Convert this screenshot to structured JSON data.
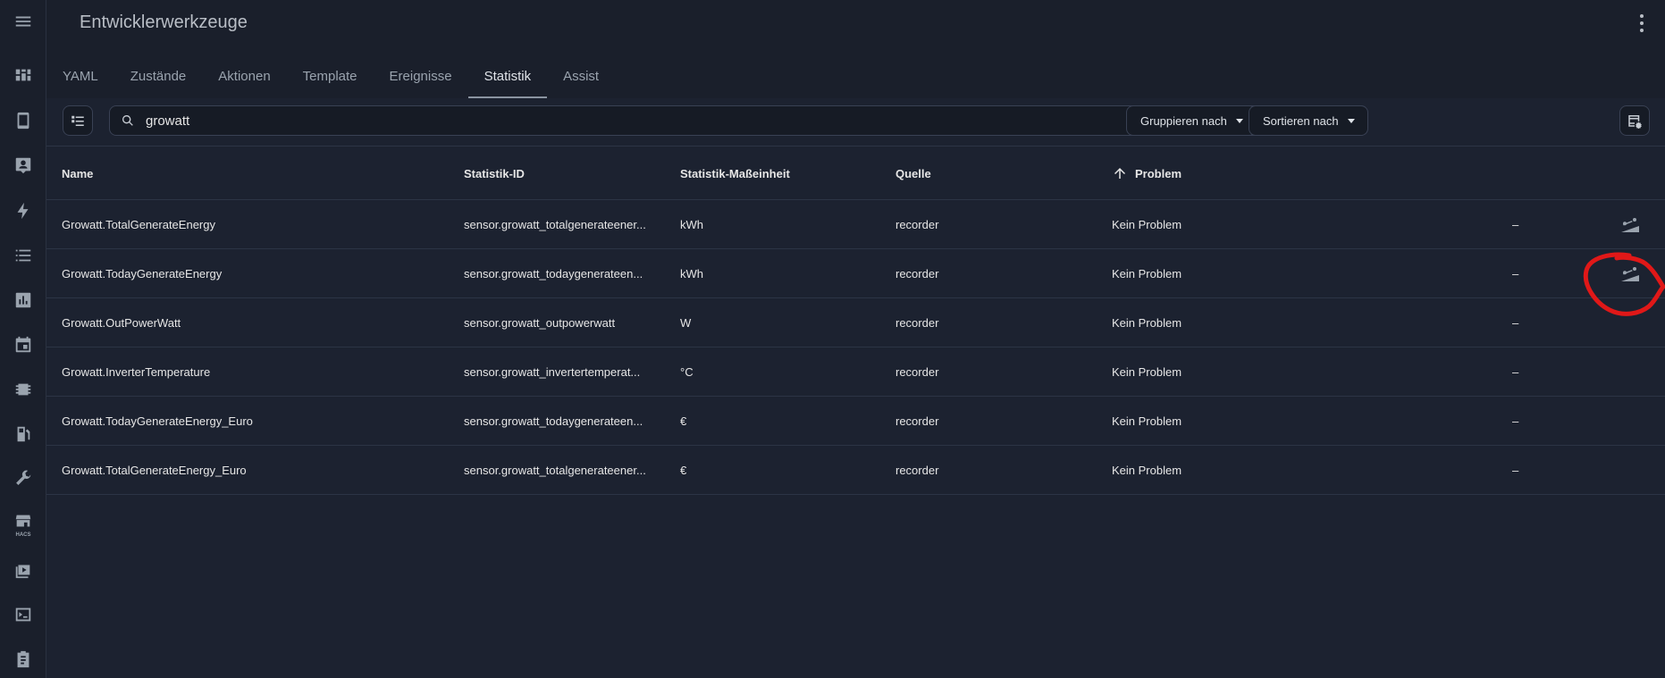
{
  "app": {
    "title": "Entwicklerwerkzeuge"
  },
  "sidebar": {
    "icons": [
      "menu-icon",
      "dashboard-icon",
      "tablet-icon",
      "account-box-icon",
      "lightning-icon",
      "list-icon",
      "chart-bar-icon",
      "calendar-icon",
      "chip-icon",
      "fuel-pump-icon",
      "wrench-icon",
      "hacs-store-icon",
      "media-play-icon",
      "console-icon",
      "clipboard-icon"
    ],
    "hacs_label": "HACS"
  },
  "tabs": [
    {
      "label": "YAML",
      "active": false
    },
    {
      "label": "Zustände",
      "active": false
    },
    {
      "label": "Aktionen",
      "active": false
    },
    {
      "label": "Template",
      "active": false
    },
    {
      "label": "Ereignisse",
      "active": false
    },
    {
      "label": "Statistik",
      "active": true
    },
    {
      "label": "Assist",
      "active": false
    }
  ],
  "toolbar": {
    "search_value": "growatt",
    "group_label": "Gruppieren nach",
    "sort_label": "Sortieren nach"
  },
  "table": {
    "columns": {
      "name": "Name",
      "id": "Statistik-ID",
      "unit": "Statistik-Maßeinheit",
      "source": "Quelle",
      "problem": "Problem"
    },
    "sort_icon": "arrow-up-icon",
    "rows": [
      {
        "name": "Growatt.TotalGenerateEnergy",
        "id": "sensor.growatt_totalgenerateener...",
        "unit": "kWh",
        "source": "recorder",
        "problem": "Kein Problem",
        "dash": "–",
        "action_icon": "adjust-sum-icon"
      },
      {
        "name": "Growatt.TodayGenerateEnergy",
        "id": "sensor.growatt_todaygenerateen...",
        "unit": "kWh",
        "source": "recorder",
        "problem": "Kein Problem",
        "dash": "–",
        "action_icon": "adjust-sum-icon"
      },
      {
        "name": "Growatt.OutPowerWatt",
        "id": "sensor.growatt_outpowerwatt",
        "unit": "W",
        "source": "recorder",
        "problem": "Kein Problem",
        "dash": "–",
        "action_icon": ""
      },
      {
        "name": "Growatt.InverterTemperature",
        "id": "sensor.growatt_invertertemperat...",
        "unit": "°C",
        "source": "recorder",
        "problem": "Kein Problem",
        "dash": "–",
        "action_icon": ""
      },
      {
        "name": "Growatt.TodayGenerateEnergy_Euro",
        "id": "sensor.growatt_todaygenerateen...",
        "unit": "€",
        "source": "recorder",
        "problem": "Kein Problem",
        "dash": "–",
        "action_icon": ""
      },
      {
        "name": "Growatt.TotalGenerateEnergy_Euro",
        "id": "sensor.growatt_totalgenerateener...",
        "unit": "€",
        "source": "recorder",
        "problem": "Kein Problem",
        "dash": "–",
        "action_icon": ""
      }
    ]
  },
  "colors": {
    "annotation": "#e01818",
    "accent": "#8a93a0"
  }
}
